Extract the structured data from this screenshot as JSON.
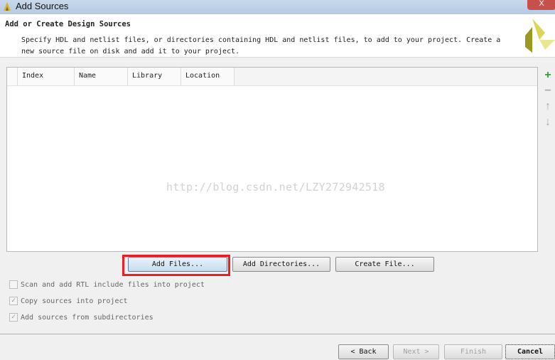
{
  "window": {
    "title": "Add Sources",
    "close_label": "X"
  },
  "header": {
    "title": "Add or Create Design Sources",
    "description": "Specify HDL and netlist files, or directories containing HDL and netlist files, to add to your project. Create a new source file on disk and add it to your project."
  },
  "table": {
    "columns": [
      "Index",
      "Name",
      "Library",
      "Location"
    ],
    "rows": []
  },
  "watermark": "http://blog.csdn.net/LZY272942518",
  "side_toolbar": {
    "icons": [
      "plus-icon",
      "minus-icon",
      "arrow-up-icon",
      "arrow-down-icon"
    ]
  },
  "buttons": {
    "add_files": "Add Files...",
    "add_directories": "Add Directories...",
    "create_file": "Create File..."
  },
  "options": [
    {
      "label": "Scan and add RTL include files into project",
      "checked": false
    },
    {
      "label": "Copy sources into project",
      "checked": true
    },
    {
      "label": "Add sources from subdirectories",
      "checked": true
    }
  ],
  "footer": {
    "back": "< Back",
    "next": "Next >",
    "finish": "Finish",
    "cancel": "Cancel"
  },
  "colors": {
    "highlight": "#ee1c25",
    "plus": "#2ea02e"
  }
}
